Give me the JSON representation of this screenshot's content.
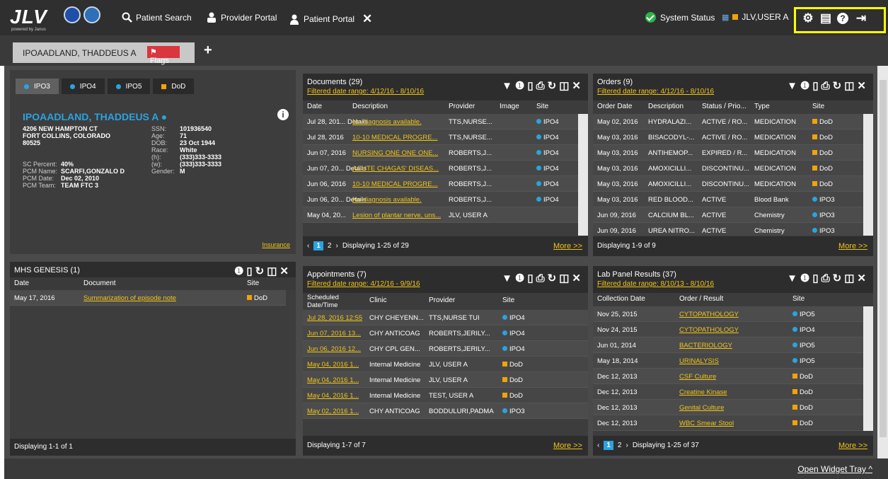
{
  "app": {
    "logo": "JLV",
    "logo_sub": "powered by Janus",
    "nav": [
      {
        "label": "Patient Search",
        "icon": "search-icon"
      },
      {
        "label": "Provider Portal",
        "icon": "provider-icon"
      },
      {
        "label": "Patient Portal",
        "icon": "person-icon"
      }
    ],
    "status": "System Status",
    "user": "JLV,USER A",
    "open_tray": "Open Widget Tray"
  },
  "patient_tab": {
    "name": "IPOAADLAND, THADDEUS A",
    "flags": "Flags"
  },
  "demo": {
    "tabs": [
      "IPO3",
      "IPO4",
      "IPO5",
      "DoD"
    ],
    "name": "IPOAADLAND, THADDEUS A",
    "addr1": "4206 NEW HAMPTON CT",
    "addr2": "FORT COLLINS, COLORADO",
    "addr3": "80525",
    "ssn_l": "SSN:",
    "ssn": "101936540",
    "age_l": "Age:",
    "age": "71",
    "dob_l": "DOB:",
    "dob": "23 Oct 1944",
    "race_l": "Race:",
    "race": "White",
    "h_l": "(h):",
    "h": "(333)333-3333",
    "w_l": "(w):",
    "w": "(333)333-3333",
    "gender_l": "Gender:",
    "gender": "M",
    "sc_l": "SC Percent:",
    "sc": "40%",
    "pcmname_l": "PCM Name:",
    "pcmname": "SCARFI,GONZALO D",
    "pcmdate_l": "PCM Date:",
    "pcmdate": "Dec 02, 2010",
    "pcmteam_l": "PCM Team:",
    "pcmteam": "TEAM FTC 3",
    "insurance": "Insurance"
  },
  "mhs": {
    "title": "MHS GENESIS (1)",
    "cols": [
      "Date",
      "Document",
      "Site"
    ],
    "rows": [
      [
        "May 17, 2016",
        "Summarization of episode note",
        "DoD"
      ]
    ],
    "footer": "Displaying 1-1 of 1"
  },
  "documents": {
    "title": "Documents (29)",
    "range": "Filtered date range: 4/12/16 - 8/10/16",
    "cols": [
      "Date",
      "Description",
      "Provider",
      "Image",
      "Site"
    ],
    "rows": [
      [
        "Jul 28, 201... Details",
        "No diagnosis available.",
        "TTS,NURSE...",
        "",
        "IPO4"
      ],
      [
        "Jul 28, 2016",
        "10-10 MEDICAL PROGRE...",
        "TTS,NURSE...",
        "",
        "IPO4"
      ],
      [
        "Jun 07, 2016",
        "NURSING ONE ONE ONE...",
        "ROBERTS,J...",
        "",
        "IPO4"
      ],
      [
        "Jun 07, 20... Details",
        "ACUTE CHAGAS' DISEAS...",
        "ROBERTS,J...",
        "",
        "IPO4"
      ],
      [
        "Jun 06, 2016",
        "10-10 MEDICAL PROGRE...",
        "ROBERTS,J...",
        "",
        "IPO4"
      ],
      [
        "Jun 06, 20... Details",
        "No diagnosis available.",
        "ROBERTS,J...",
        "",
        "IPO4"
      ],
      [
        "May 04, 20...",
        "Lesion of plantar nerve, uns...",
        "JLV, USER A",
        "",
        ""
      ]
    ],
    "page": "1",
    "page2": "2",
    "footer": "Displaying 1-25 of 29",
    "more": "More >>"
  },
  "orders": {
    "title": "Orders (9)",
    "range": "Filtered date range: 4/12/16 - 8/10/16",
    "cols": [
      "Order Date",
      "Description",
      "Status / Prio...",
      "Type",
      "Site"
    ],
    "rows": [
      [
        "May 02, 2016",
        "HYDRALAZI...",
        "ACTIVE / RO...",
        "MEDICATION",
        "DoD"
      ],
      [
        "May 03, 2016",
        "BISACODYL-...",
        "ACTIVE / RO...",
        "MEDICATION",
        "DoD"
      ],
      [
        "May 03, 2016",
        "ANTIHEMOP...",
        "EXPIRED / R...",
        "MEDICATION",
        "DoD"
      ],
      [
        "May 03, 2016",
        "AMOXICILLI...",
        "DISCONTINU...",
        "MEDICATION",
        "DoD"
      ],
      [
        "May 03, 2016",
        "AMOXICILLI...",
        "DISCONTINU...",
        "MEDICATION",
        "DoD"
      ],
      [
        "May 03, 2016",
        "RED BLOOD...",
        "ACTIVE",
        "Blood Bank",
        "IPO3"
      ],
      [
        "Jun 09, 2016",
        "CALCIUM BL...",
        "ACTIVE",
        "Chemistry",
        "IPO3"
      ],
      [
        "Jun 09, 2016",
        "UREA NITRO...",
        "ACTIVE",
        "Chemistry",
        "IPO3"
      ]
    ],
    "footer": "Displaying 1-9 of 9",
    "more": "More >>"
  },
  "appointments": {
    "title": "Appointments (7)",
    "range": "Filtered date range: 4/12/16 - 9/9/16",
    "cols": [
      "Scheduled Date/Time",
      "Clinic",
      "Provider",
      "Site"
    ],
    "rows": [
      [
        "Jul 28, 2016 12:55",
        "CHY CHEYENN...",
        "TTS,NURSE TUI",
        "IPO4"
      ],
      [
        "Jun 07, 2016 13...",
        "CHY ANTICOAG",
        "ROBERTS,JERILY...",
        "IPO4"
      ],
      [
        "Jun 06, 2016 12...",
        "CHY CPL GEN...",
        "ROBERTS,JERILY...",
        "IPO4"
      ],
      [
        "May 04, 2016 1...",
        "Internal Medicine",
        "JLV, USER A",
        "DoD"
      ],
      [
        "May 04, 2016 1...",
        "Internal Medicine",
        "JLV, USER A",
        "DoD"
      ],
      [
        "May 04, 2016 1...",
        "Internal Medicine",
        "TEST, USER A",
        "DoD"
      ],
      [
        "May 02, 2016 1...",
        "CHY ANTICOAG",
        "BODDULURI,PADMA",
        "IPO3"
      ]
    ],
    "footer": "Displaying 1-7 of 7",
    "more": "More >>"
  },
  "labs": {
    "title": "Lab Panel Results (37)",
    "range": "Filtered date range: 8/10/13 - 8/10/16",
    "cols": [
      "Collection Date",
      "Order / Result",
      "Site"
    ],
    "rows": [
      [
        "Nov 25, 2015",
        "CYTOPATHOLOGY",
        "IPO5"
      ],
      [
        "Nov 24, 2015",
        "CYTOPATHOLOGY",
        "IPO4"
      ],
      [
        "Jun 01, 2014",
        "BACTERIOLOGY",
        "IPO5"
      ],
      [
        "May 18, 2014",
        "URINALYSIS",
        "IPO5"
      ],
      [
        "Dec 12, 2013",
        "CSF Culture",
        "DoD"
      ],
      [
        "Dec 12, 2013",
        "Creatine Kinase",
        "DoD"
      ],
      [
        "Dec 12, 2013",
        "Genital Culture",
        "DoD"
      ],
      [
        "Dec 12, 2013",
        "WBC Smear Stool",
        "DoD"
      ]
    ],
    "page": "1",
    "page2": "2",
    "footer": "Displaying 1-25 of 37",
    "more": "More >>"
  }
}
